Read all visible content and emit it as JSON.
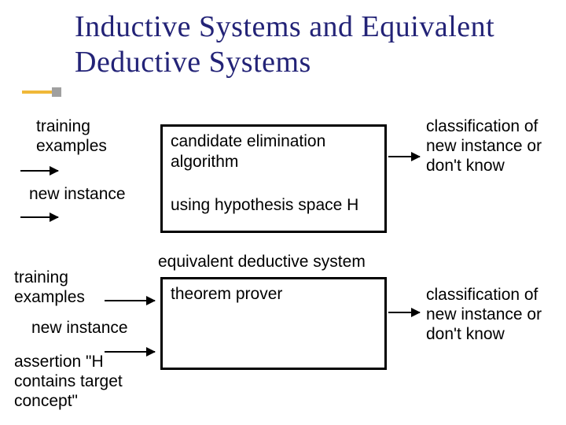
{
  "title": "Inductive Systems and Equivalent Deductive Systems",
  "top": {
    "input1": "training examples",
    "input2": "new instance",
    "box_l1": "candidate elimination algorithm",
    "box_l2": "using hypothesis space H",
    "output": "classification of new instance or don't know"
  },
  "bottom": {
    "over": "equivalent deductive system",
    "input1": "training examples",
    "input2": "new instance",
    "input3": "assertion \"H contains target concept\"",
    "box": "theorem prover",
    "output": "classification of new instance or don't know"
  }
}
